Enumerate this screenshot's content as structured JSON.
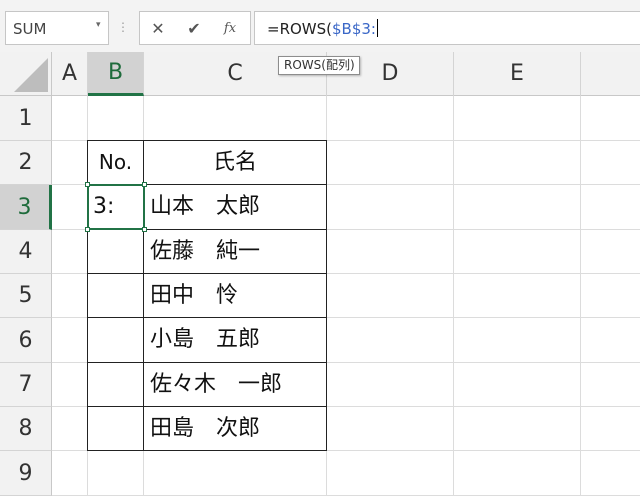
{
  "formula_bar": {
    "name_box": "SUM",
    "name_box_arrow": "▾",
    "separator": "⋮",
    "cancel_glyph": "✕",
    "enter_glyph": "✔",
    "insert_function_glyph": "fx",
    "formula_prefix": "=ROWS(",
    "formula_reference": "$B$3:"
  },
  "tooltip": {
    "text": "ROWS(配列)"
  },
  "columns": [
    "A",
    "B",
    "C",
    "D",
    "E"
  ],
  "rows": [
    "1",
    "2",
    "3",
    "4",
    "5",
    "6",
    "7",
    "8",
    "9"
  ],
  "active": {
    "column": "B",
    "row": "3"
  },
  "table": {
    "header_no": "No.",
    "header_name": "氏名",
    "editing_cell_value": "3:",
    "names": [
      "山本　太郎",
      "佐藤　純一",
      "田中　怜",
      "小島　五郎",
      "佐々木　一郎",
      "田島　次郎"
    ]
  },
  "colors": {
    "accent": "#217346",
    "reference_blue": "#3a67c7"
  }
}
